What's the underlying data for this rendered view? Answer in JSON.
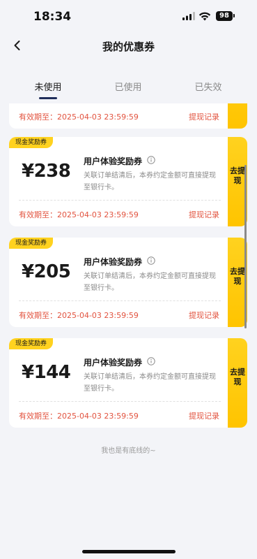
{
  "status_bar": {
    "time": "18:34",
    "battery": "98",
    "icons": [
      "signal-icon",
      "wifi-icon",
      "battery-icon"
    ]
  },
  "header": {
    "title": "我的优惠券",
    "back_icon": "chevron-left-icon"
  },
  "tabs": [
    {
      "label": "未使用",
      "active": true
    },
    {
      "label": "已使用",
      "active": false
    },
    {
      "label": "已失效",
      "active": false
    }
  ],
  "coupons": [
    {
      "badge": "",
      "amount": "",
      "name": "",
      "desc": "",
      "expiry": "有效期至：2025-04-03 23:59:59",
      "record_label": "提现记录",
      "action_label": ""
    },
    {
      "badge": "现金奖励券",
      "amount": "¥238",
      "name": "用户体验奖励券",
      "desc": "关联订单结清后，本券约定金额可直接提现至银行卡。",
      "expiry": "有效期至：2025-04-03 23:59:59",
      "record_label": "提现记录",
      "action_label": "去提现"
    },
    {
      "badge": "现金奖励券",
      "amount": "¥205",
      "name": "用户体验奖励券",
      "desc": "关联订单结清后，本券约定金额可直接提现至银行卡。",
      "expiry": "有效期至：2025-04-03 23:59:59",
      "record_label": "提现记录",
      "action_label": "去提现"
    },
    {
      "badge": "现金奖励券",
      "amount": "¥144",
      "name": "用户体验奖励券",
      "desc": "关联订单结清后，本券约定金额可直接提现至银行卡。",
      "expiry": "有效期至：2025-04-03 23:59:59",
      "record_label": "提现记录",
      "action_label": "去提现"
    }
  ],
  "footer_note": "我也是有底线的~",
  "colors": {
    "accent_yellow": "#ffc400",
    "expiry_red": "#e2533f",
    "background": "#f3f4f8",
    "indicator": "#1f2d5a"
  }
}
